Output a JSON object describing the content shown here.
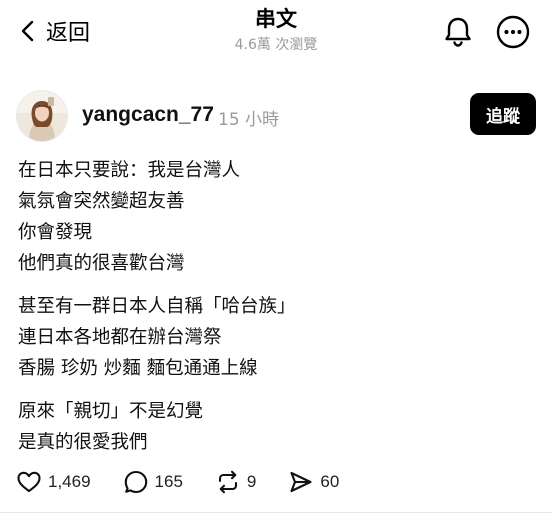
{
  "header": {
    "back_label": "返回",
    "title": "串文",
    "views": "4.6萬 次瀏覽"
  },
  "post": {
    "username": "yangcacn_77",
    "timestamp": "15 小時",
    "follow_label": "追蹤",
    "paragraphs": [
      [
        "在日本只要說：我是台灣人",
        "氣氛會突然變超友善",
        "你會發現",
        "他們真的很喜歡台灣"
      ],
      [
        "甚至有一群日本人自稱「哈台族」",
        "連日本各地都在辦台灣祭",
        "香腸 珍奶 炒麵 麵包通通上線"
      ],
      [
        "原來「親切」不是幻覺",
        "是真的很愛我們"
      ]
    ],
    "stats": {
      "likes": "1,469",
      "comments": "165",
      "reposts": "9",
      "shares": "60"
    }
  },
  "icons": {
    "back": "chevron-left-icon",
    "notifications": "bell-icon",
    "more": "more-horizontal-icon",
    "like": "heart-icon",
    "comment": "comment-bubble-icon",
    "repost": "repost-icon",
    "share": "send-icon"
  },
  "colors": {
    "text": "#111111",
    "muted": "#9a9a9a",
    "follow_bg": "#000000",
    "follow_text": "#ffffff"
  }
}
